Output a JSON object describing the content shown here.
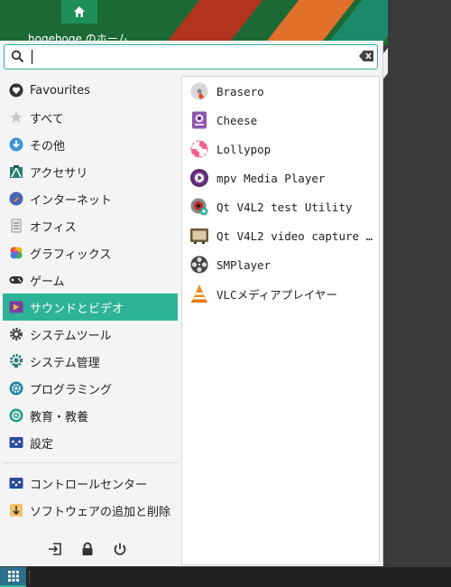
{
  "desktop": {
    "home_icon": "home-icon",
    "home_label": "hogehoge のホーム"
  },
  "search": {
    "value": "",
    "placeholder": ""
  },
  "categories": [
    {
      "label": "Favourites",
      "icon": "heart-icon"
    },
    {
      "label": "すべて",
      "icon": "star-icon"
    },
    {
      "label": "その他",
      "icon": "download-icon"
    },
    {
      "label": "アクセサリ",
      "icon": "accessories-icon"
    },
    {
      "label": "インターネット",
      "icon": "internet-icon"
    },
    {
      "label": "オフィス",
      "icon": "office-icon"
    },
    {
      "label": "グラフィックス",
      "icon": "graphics-icon"
    },
    {
      "label": "ゲーム",
      "icon": "gamepad-icon"
    },
    {
      "label": "サウンドとビデオ",
      "icon": "multimedia-icon",
      "active": true
    },
    {
      "label": "システムツール",
      "icon": "gear-icon"
    },
    {
      "label": "システム管理",
      "icon": "system-admin-icon"
    },
    {
      "label": "プログラミング",
      "icon": "programming-icon"
    },
    {
      "label": "教育・教養",
      "icon": "education-icon"
    },
    {
      "label": "設定",
      "icon": "settings-icon"
    }
  ],
  "extra": [
    {
      "label": "コントロールセンター",
      "icon": "control-center-icon"
    },
    {
      "label": "ソフトウェアの追加と削除",
      "icon": "software-install-icon"
    }
  ],
  "actions": {
    "logout": "logout-icon",
    "lock": "lock-icon",
    "power": "power-icon"
  },
  "apps": [
    {
      "label": "Brasero",
      "icon": "brasero-icon"
    },
    {
      "label": "Cheese",
      "icon": "cheese-icon"
    },
    {
      "label": "Lollypop",
      "icon": "lollypop-icon"
    },
    {
      "label": "mpv Media Player",
      "icon": "mpv-icon"
    },
    {
      "label": "Qt V4L2 test Utility",
      "icon": "qv4l2-icon"
    },
    {
      "label": "Qt V4L2 video capture u…",
      "icon": "qvidcap-icon"
    },
    {
      "label": "SMPlayer",
      "icon": "smplayer-icon"
    },
    {
      "label": "VLCメディアプレイヤー",
      "icon": "vlc-icon"
    }
  ],
  "colors": {
    "accent": "#2eb398",
    "menu_bg": "#f4f4f4",
    "taskbar_bg": "#222222"
  }
}
